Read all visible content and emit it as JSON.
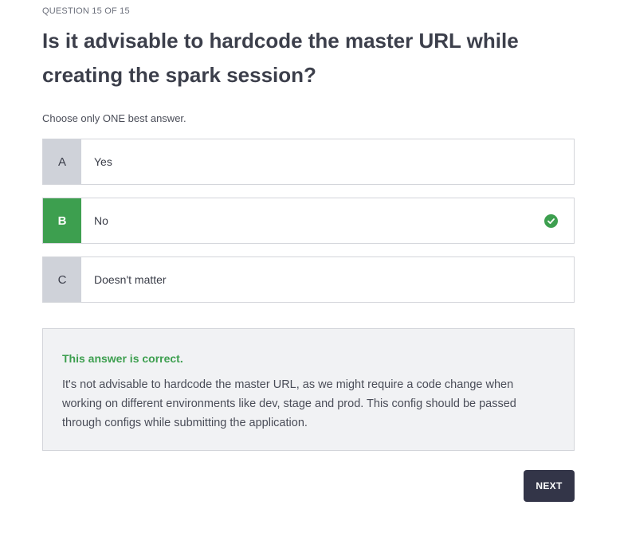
{
  "quiz": {
    "counter": "QUESTION 15 OF 15",
    "question": "Is it advisable to hardcode the master URL while creating the spark session?",
    "instruction": "Choose only ONE best answer.",
    "options": [
      {
        "letter": "A",
        "text": "Yes",
        "state": "default"
      },
      {
        "letter": "B",
        "text": "No",
        "state": "correct"
      },
      {
        "letter": "C",
        "text": "Doesn't matter",
        "state": "default"
      }
    ]
  },
  "feedback": {
    "status": "This answer is correct.",
    "explanation": "It's not advisable to hardcode the master URL, as we might require a code change when working on different environments like dev, stage and prod. This config should be passed through configs while submitting the application."
  },
  "actions": {
    "next_label": "NEXT"
  },
  "colors": {
    "correct": "#3d9f4f",
    "letter_bg": "#cfd2d9",
    "button_bg": "#333548",
    "feedback_bg": "#f1f2f4"
  },
  "icons": {
    "correct_indicator": "check-circle-icon"
  }
}
